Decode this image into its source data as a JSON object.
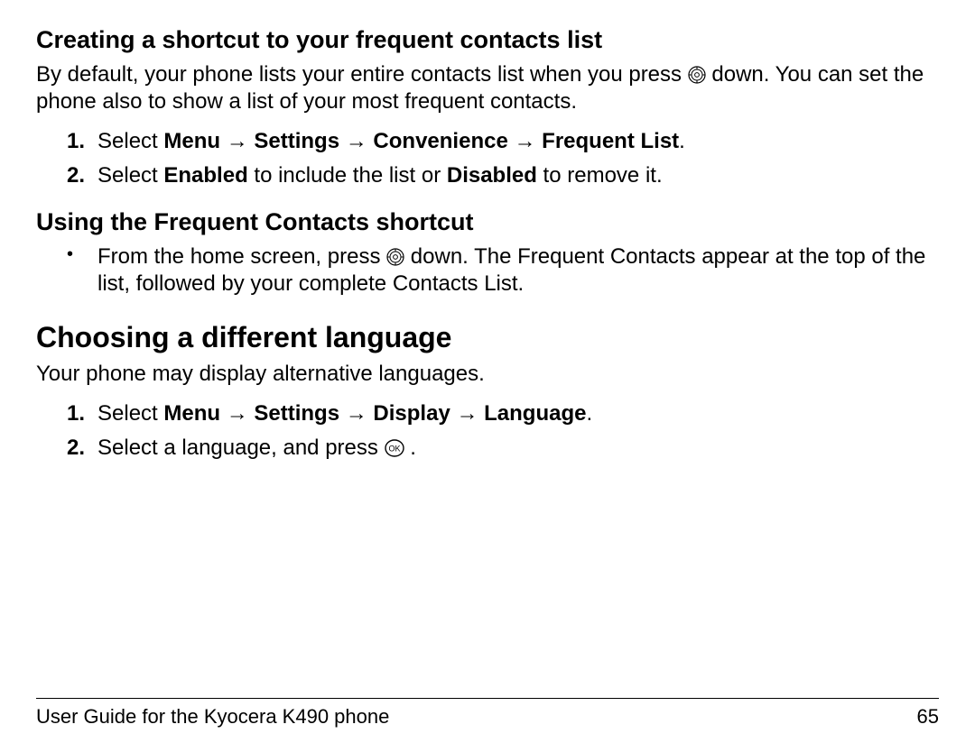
{
  "sec1": {
    "heading": "Creating a shortcut to your frequent contacts list",
    "para_a": "By default, your phone lists your entire contacts list when you press ",
    "para_b": " down. You can set the phone also to show a list of your most frequent contacts.",
    "step1_a": "Select ",
    "step1_b": "Menu",
    "step1_c": "Settings",
    "step1_d": "Convenience",
    "step1_e": "Frequent List",
    "step1_f": ".",
    "step2_a": "Select ",
    "step2_b": "Enabled",
    "step2_c": " to include the list or ",
    "step2_d": "Disabled",
    "step2_e": " to remove it."
  },
  "sec2": {
    "heading": "Using the Frequent Contacts shortcut",
    "b1_a": "From the home screen, press ",
    "b1_b": " down. The Frequent Contacts appear at the top of the list, followed by your complete Contacts List."
  },
  "sec3": {
    "heading": "Choosing a different language",
    "para": "Your phone may display alternative languages.",
    "step1_a": "Select ",
    "step1_b": "Menu",
    "step1_c": "Settings",
    "step1_d": "Display",
    "step1_e": "Language",
    "step1_f": ".",
    "step2_a": "Select a language, and press ",
    "step2_b": "."
  },
  "arrow": " → ",
  "footer": {
    "left": "User Guide for the Kyocera K490 phone",
    "right": "65"
  }
}
